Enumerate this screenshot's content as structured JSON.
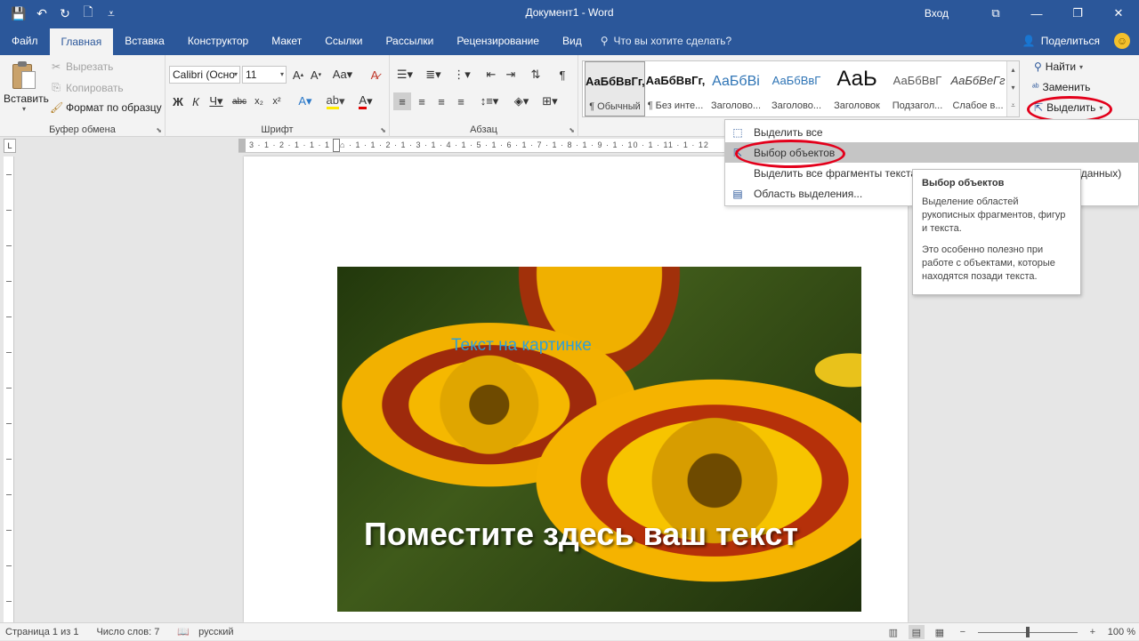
{
  "window": {
    "title": "Документ1 - Word",
    "signin": "Вход",
    "qat": {
      "save": "💾",
      "undo": "↶",
      "redo": "↻",
      "new": "🗋",
      "more": "⩡"
    }
  },
  "tabs": [
    "Файл",
    "Главная",
    "Вставка",
    "Конструктор",
    "Макет",
    "Ссылки",
    "Рассылки",
    "Рецензирование",
    "Вид"
  ],
  "active_tab": "Главная",
  "tell_me": "Что вы хотите сделать?",
  "share": "Поделиться",
  "clipboard": {
    "paste": "Вставить",
    "cut": "Вырезать",
    "copy": "Копировать",
    "format_painter": "Формат по образцу",
    "label": "Буфер обмена"
  },
  "font": {
    "name": "Calibri (Осно",
    "size": "11",
    "label": "Шрифт"
  },
  "paragraph": {
    "label": "Абзац"
  },
  "styles": [
    {
      "sample": "АаБбВвГг,",
      "name": "¶ Обычный"
    },
    {
      "sample": "АаБбВвГг,",
      "name": "¶ Без инте..."
    },
    {
      "sample": "АаБбВі",
      "name": "Заголово..."
    },
    {
      "sample": "АаБбВвГ",
      "name": "Заголово..."
    },
    {
      "sample": "АаЬ",
      "name": "Заголовок"
    },
    {
      "sample": "АаБбВвГ",
      "name": "Подзагол..."
    },
    {
      "sample": "АаБбВеГг",
      "name": "Слабое в..."
    }
  ],
  "editing": {
    "find": "Найти",
    "replace": "Заменить",
    "select": "Выделить"
  },
  "select_menu": {
    "items": [
      "Выделить все",
      "Выбор объектов",
      "Выделить все фрагменты текста с",
      "Область выделения..."
    ],
    "overflow_text": "г данных)"
  },
  "tooltip": {
    "title": "Выбор объектов",
    "p1": "Выделение областей рукописных фрагментов, фигур и текста.",
    "p2": "Это особенно полезно при работе с объектами, которые находятся позади текста."
  },
  "ruler": {
    "ticks": "3 · 1 · 2 · 1 · 1 · 1 · ⌂ · 1 · 1 · 2 · 1 · 3 · 1 · 4 · 1 · 5 · 1 · 6 · 1 · 7 · 1 · 8 · 1 · 9 · 1 · 10 · 1 · 11 · 1 · 12"
  },
  "document": {
    "image_caption_small": "Текст на картинке",
    "image_caption_big": "Поместите здесь ваш текст"
  },
  "statusbar": {
    "page": "Страница 1 из 1",
    "words": "Число слов: 7",
    "language": "русский",
    "zoom": "100 %"
  }
}
